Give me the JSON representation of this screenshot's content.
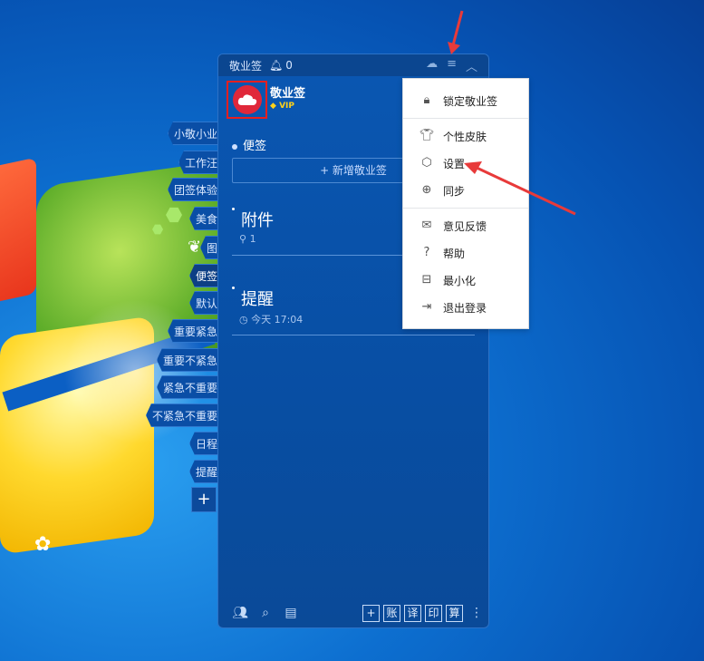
{
  "panel": {
    "title": "敬业签",
    "bell_count": "0",
    "user_name": "敬业签",
    "vip": "VIP",
    "section": "便签",
    "add_note_label": "+ 新增敬业签",
    "notes": [
      {
        "title": "附件",
        "meta": "1",
        "meta_icon": "paperclip-icon"
      },
      {
        "title": "提醒",
        "meta": "今天 17:04",
        "meta_icon": "clock-icon"
      }
    ],
    "bottom_buttons": [
      "账",
      "译",
      "印",
      "算"
    ]
  },
  "tags": [
    "小敬小业",
    "工作汪",
    "团签体验",
    "美食",
    "图",
    "便签",
    "默认",
    "重要紧急",
    "重要不紧急",
    "紧急不重要",
    "不紧急不重要",
    "日程",
    "提醒"
  ],
  "menu": {
    "items": [
      "锁定敬业签",
      "个性皮肤",
      "设置",
      "同步",
      "意见反馈",
      "帮助",
      "最小化",
      "退出登录"
    ]
  },
  "colors": {
    "accent_red": "#e83a3a",
    "panel_bg": "#0a57b2",
    "vip_gold": "#ffd21a"
  }
}
